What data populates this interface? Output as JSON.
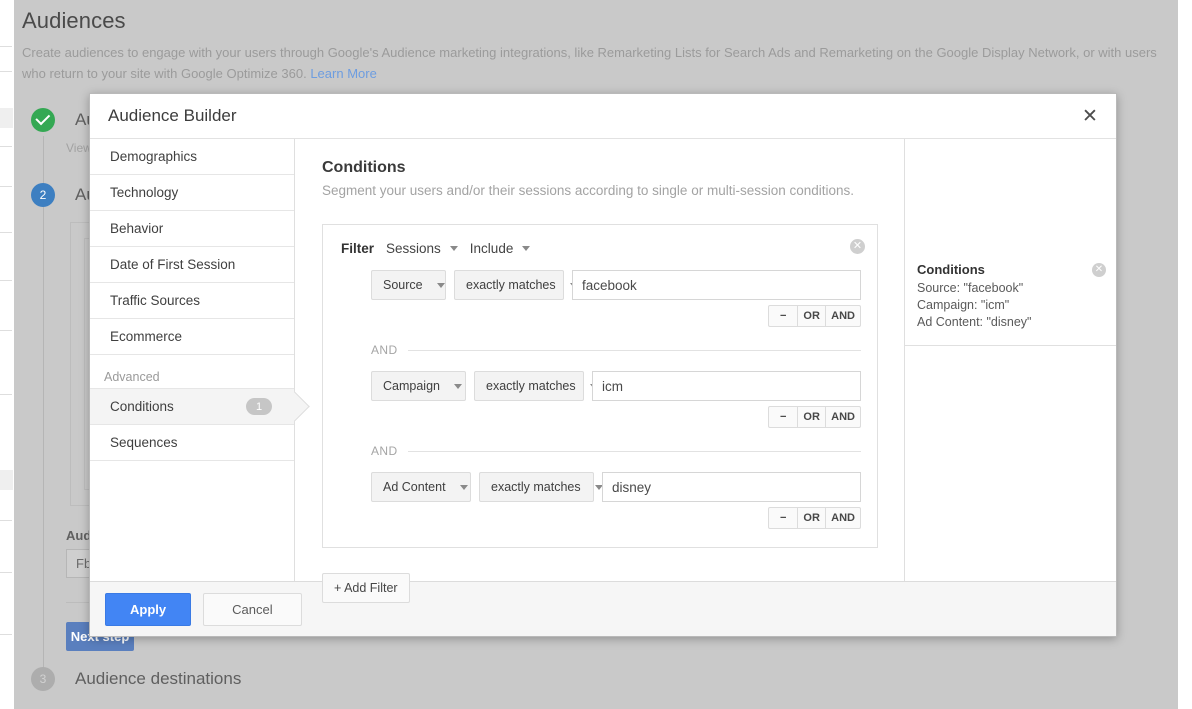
{
  "page": {
    "title": "Audiences",
    "description": "Create audiences to engage with your users through Google's Audience marketing integrations, like Remarketing Lists for Search Ads and Remarketing on the Google Display Network, or with users who return to your site with Google Optimize 360.",
    "learn_more": "Learn More",
    "steps": [
      {
        "number": "",
        "label": "Audience source",
        "sub": "View"
      },
      {
        "number": "2",
        "label": "Audience definition",
        "sub": ""
      },
      {
        "number": "3",
        "label": "Audience destinations",
        "sub": ""
      }
    ],
    "bg_field_label": "Audience name",
    "bg_field_value": "Fb",
    "bg_next_button": "Next step"
  },
  "modal": {
    "title": "Audience Builder",
    "close_icon": "close-icon",
    "nav": {
      "items": [
        {
          "label": "Demographics",
          "badge": "",
          "selected": false
        },
        {
          "label": "Technology",
          "badge": "",
          "selected": false
        },
        {
          "label": "Behavior",
          "badge": "",
          "selected": false
        },
        {
          "label": "Date of First Session",
          "badge": "",
          "selected": false
        },
        {
          "label": "Traffic Sources",
          "badge": "",
          "selected": false
        },
        {
          "label": "Ecommerce",
          "badge": "",
          "selected": false
        }
      ],
      "group_label": "Advanced",
      "advanced_items": [
        {
          "label": "Conditions",
          "badge": "1",
          "selected": true
        },
        {
          "label": "Sequences",
          "badge": "",
          "selected": false
        }
      ]
    },
    "content": {
      "title": "Conditions",
      "subtitle": "Segment your users and/or their sessions according to single or multi-session conditions.",
      "filter": {
        "word": "Filter",
        "scope": "Sessions",
        "mode": "Include",
        "remove_icon": "remove-filter-icon",
        "rows": [
          {
            "dimension": "Source",
            "operator": "exactly matches",
            "value": "facebook",
            "ops": {
              "minus": "−",
              "or": "OR",
              "and": "AND"
            }
          },
          {
            "dimension": "Campaign",
            "operator": "exactly matches",
            "value": "icm",
            "ops": {
              "minus": "−",
              "or": "OR",
              "and": "AND"
            }
          },
          {
            "dimension": "Ad Content",
            "operator": "exactly matches",
            "value": "disney",
            "ops": {
              "minus": "−",
              "or": "OR",
              "and": "AND"
            }
          }
        ],
        "joiner": "AND"
      },
      "add_filter": "+ Add Filter"
    },
    "summary": {
      "title": "Conditions",
      "remove_icon": "remove-summary-icon",
      "lines": [
        "Source: \"facebook\"",
        "Campaign: \"icm\"",
        "Ad Content: \"disney\""
      ]
    },
    "footer": {
      "apply": "Apply",
      "cancel": "Cancel"
    }
  },
  "colors": {
    "accent_blue": "#4285f4",
    "step_done_green": "#34a853",
    "step_active_blue": "#3d7fc1",
    "overlay_gray": "#c9c9c9"
  }
}
